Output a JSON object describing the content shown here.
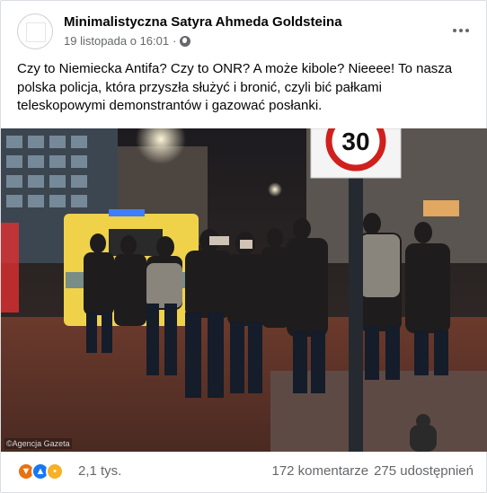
{
  "post": {
    "page_name": "Minimalistyczna Satyra Ahmeda Goldsteina",
    "date": "19 listopada o 16:01",
    "separator": "·",
    "text": "Czy to Niemiecka Antifa? Czy to ONR? A może kibole? Nieeee! To nasza polska policja, która przyszła służyć i bronić, czyli bić pałkami teleskopowymi demonstrantów i gazować posłanki.",
    "more_icon": "more-horizontal-icon",
    "audience_icon": "globe-icon"
  },
  "photo": {
    "credit": "©Agencja Gazeta",
    "sign_number": "30"
  },
  "footer": {
    "reaction_icons": [
      "angry-icon",
      "like-icon",
      "sad-icon"
    ],
    "reaction_count": "2,1 tys.",
    "comments": "172 komentarze",
    "shares": "275 udostępnień"
  },
  "colors": {
    "text": "#050505",
    "secondary": "#65676b",
    "like": "#1877f2",
    "angry": "#e9710f",
    "sad": "#f7b125"
  }
}
